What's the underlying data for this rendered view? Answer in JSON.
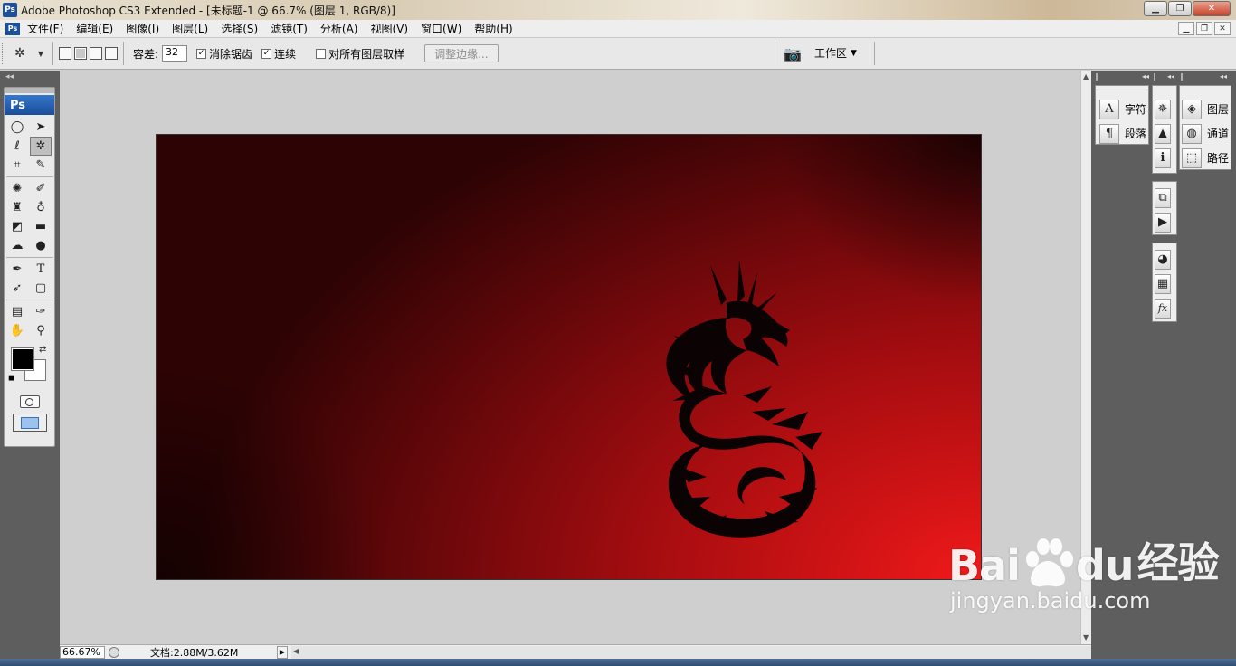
{
  "window": {
    "title": "Adobe Photoshop CS3 Extended - [未标题-1 @ 66.7% (图层 1, RGB/8)]",
    "app_icon": "Ps"
  },
  "menu": {
    "items": [
      "文件(F)",
      "编辑(E)",
      "图像(I)",
      "图层(L)",
      "选择(S)",
      "滤镜(T)",
      "分析(A)",
      "视图(V)",
      "窗口(W)",
      "帮助(H)"
    ]
  },
  "options": {
    "tolerance_label": "容差:",
    "tolerance_value": "32",
    "antialias_label": "消除锯齿",
    "antialias_checked": true,
    "contiguous_label": "连续",
    "contiguous_checked": true,
    "sample_all_label": "对所有图层取样",
    "sample_all_checked": false,
    "refine_edge_label": "调整边缘...",
    "workspace_label": "工作区"
  },
  "toolbox": {
    "logo": "Ps",
    "foreground_color": "#000000",
    "background_color": "#ffffff"
  },
  "panels": {
    "character": "字符",
    "paragraph": "段落",
    "layers": "图层",
    "channels": "通道",
    "paths": "路径"
  },
  "status": {
    "zoom": "66.67%",
    "doc_info": "文档:2.88M/3.62M"
  },
  "canvas": {
    "accent_colors": [
      "#f01a1a",
      "#a60d10",
      "#2e0304"
    ]
  },
  "watermark": {
    "logo_left": "Bai",
    "logo_mid": "du",
    "logo_right": "经验",
    "url": "jingyan.baidu.com"
  }
}
